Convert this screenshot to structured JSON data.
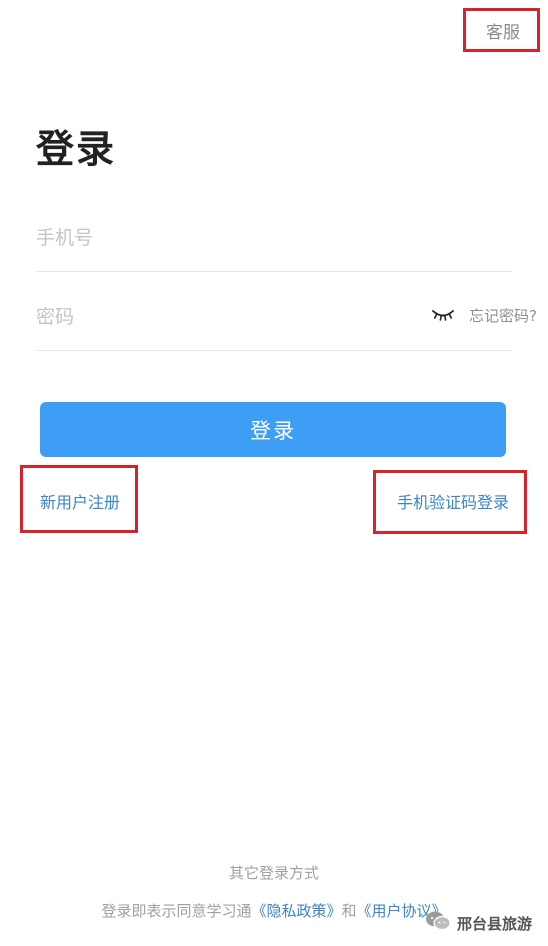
{
  "header": {
    "service_label": "客服"
  },
  "page_title": "登录",
  "form": {
    "phone_placeholder": "手机号",
    "phone_value": "",
    "password_placeholder": "密码",
    "password_value": "",
    "forgot_label": "忘记密码?",
    "password_toggle_icon": "eye-closed-icon"
  },
  "login_button_label": "登录",
  "links": {
    "register_label": "新用户注册",
    "sms_login_label": "手机验证码登录"
  },
  "footer": {
    "other_methods_label": "其它登录方式",
    "agreement_prefix": "登录即表示同意学习通",
    "privacy_label": "《隐私政策》",
    "agreement_and": "和",
    "user_agreement_label": "《用户协议》"
  },
  "watermark": {
    "label": "邢台县旅游",
    "icon": "wechat-icon"
  },
  "colors": {
    "accent": "#3e9df4",
    "link": "#3a86c8",
    "highlight_box": "#d8222c",
    "placeholder": "#c4c4c4"
  }
}
